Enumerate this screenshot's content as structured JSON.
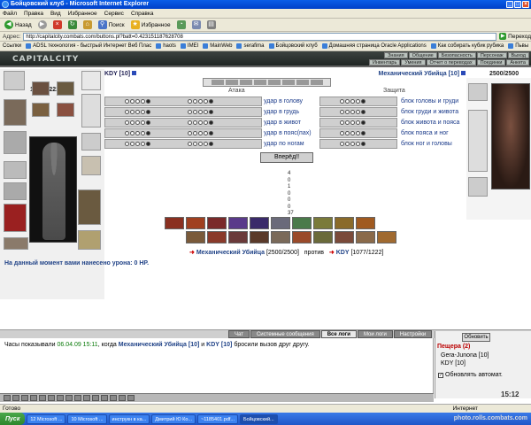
{
  "window": {
    "title": "Бойцовский клуб - Microsoft Internet Explorer"
  },
  "menu": [
    "Файл",
    "Правка",
    "Вид",
    "Избранное",
    "Сервис",
    "Справка"
  ],
  "toolbar": {
    "back": "Назад",
    "search": "Поиск",
    "favorites": "Избранное"
  },
  "address": {
    "label": "Адрес:",
    "url": "http://capitalcity.combats.com/buttons.pl?batt=0.423151187628708",
    "go": "Переход"
  },
  "links": [
    "Ссылки",
    "ADSL технология - быстрый Интернет Веб Плас",
    "haots",
    "IMEI",
    "MainWeb",
    "serafima",
    "Бойцовский клуб",
    "Домашняя страница Oracle Applications",
    "Как собирать кубик рубика",
    "Пьвы"
  ],
  "game": {
    "logo": "CAPITALCITY",
    "nav_top": [
      "Знания",
      "Общение",
      "Безопасность",
      "Персонаж",
      "Выход"
    ],
    "nav_bottom": [
      "Инвентарь",
      "Умения",
      "Отчет о переводах",
      "Поединки",
      "Анкета"
    ],
    "hp_left": "1077/1222",
    "hp_right": "2500/2500",
    "player_name": "KDY [10]",
    "enemy_name": "Механический Убийца [10]",
    "attack_header": "Атака",
    "defense_header": "Защита",
    "attacks": [
      "удар в голову",
      "удар в грудь",
      "удар в живот",
      "удар в пояс(пах)",
      "удар по ногам"
    ],
    "blocks": [
      "блок головы и груди",
      "блок груди и живота",
      "блок живота и пояса",
      "блок пояса и ног",
      "блок ног и головы"
    ],
    "forward_button": "Вперёд!!",
    "stats": [
      "4",
      "0",
      "1",
      "0",
      "0",
      "0",
      "37"
    ],
    "vs": {
      "enemy": "Механический Убийца",
      "enemy_hp": "[2500/2500]",
      "versus": "против",
      "player": "KDY",
      "player_hp": "[1077/1222]"
    },
    "damage_text": "На данный момент вами нанесено урона: 0 HP."
  },
  "chat_tabs": [
    "Чат",
    "Системные сообщения",
    "Все логи",
    "Мои логи",
    "Настройки"
  ],
  "chat_active_tab": "Все логи",
  "chat": {
    "p1": "Часы показывали",
    "time": "06.04.09 15:11",
    "p2": ", когда",
    "enemy": "Механический Убийца",
    "enemy_lvl": "[10]",
    "p3": "и",
    "player": "KDY",
    "player_lvl": "[10]",
    "p4": "бросили вызов друг другу."
  },
  "side": {
    "refresh_button": "Обновить",
    "location": "Пещера (2)",
    "players": [
      "Gera-Junona [10]",
      "KDY [10]"
    ],
    "auto_label": "Обновлять автомат."
  },
  "clock": "15:12",
  "status": {
    "left": "Готово",
    "zone": "Интернет"
  },
  "taskbar": {
    "start": "Пуск",
    "items": [
      "12 Microsoft ...",
      "10 Microsoft ...",
      "инструкн в ка...",
      "Дмитрий Ю Ко...",
      "~1185401.pdf...",
      "Бойцовский..."
    ],
    "watermark": "photo.rolls.combats.com"
  }
}
